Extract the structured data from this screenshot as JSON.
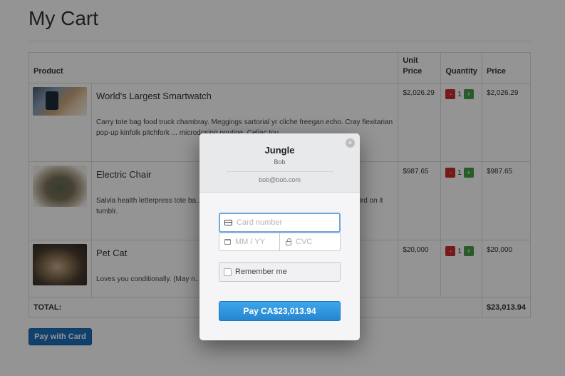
{
  "page": {
    "title": "My Cart"
  },
  "table": {
    "headers": {
      "product": "Product",
      "unit_price": "Unit Price",
      "quantity": "Quantity",
      "price": "Price"
    },
    "items": [
      {
        "name": "World's Largest Smartwatch",
        "description": "Carry tote bag food truck chambray. Meggings sartorial yr cliche freegan echo. Cray flexitarian pop-up kinfolk pitchfork ... microdosing poutine. Celiac tou...",
        "unit_price": "$2,026.29",
        "qty": "1",
        "price": "$2,026.29",
        "image_icon": "smartwatch-photo"
      },
      {
        "name": "Electric Chair",
        "description": "Salvia health letterpress tote ba... toast typewriter godard pabst e... Polaroid put a bird on it tumblr.",
        "unit_price": "$987.65",
        "qty": "1",
        "price": "$987.65",
        "image_icon": "chair-photo"
      },
      {
        "name": "Pet Cat",
        "description": "Loves you conditionally. (May n...",
        "unit_price": "$20,000",
        "qty": "1",
        "price": "$20,000",
        "image_icon": "cat-photo"
      }
    ],
    "total_label": "TOTAL:",
    "total_value": "$23,013.94",
    "minus_label": "-",
    "plus_label": "+"
  },
  "pay_with_card_label": "Pay with Card",
  "modal": {
    "title": "Jungle",
    "subtitle": "Bob",
    "email": "bob@bob.com",
    "close_icon": "×",
    "card_placeholder": "Card number",
    "exp_placeholder": "MM / YY",
    "cvc_placeholder": "CVC",
    "remember_label": "Remember me",
    "pay_label": "Pay CA$23,013.94",
    "colors": {
      "pay_button": "#2c93dd",
      "card_focus": "#6fa8dc",
      "overlay": "rgba(0,0,0,0.42)"
    }
  }
}
